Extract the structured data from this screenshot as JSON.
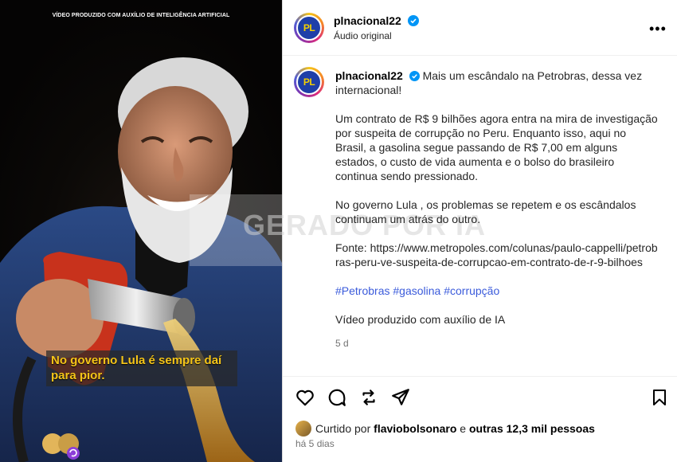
{
  "media": {
    "ai_notice": "VÍDEO PRODUZIDO COM AUXÍLIO DE INTELIGÊNCIA ARTIFICIAL",
    "watermark": "GERADO POR IA",
    "caption": "No governo Lula é sempre daí para pior."
  },
  "header": {
    "avatar_text": "PL",
    "username": "plnacional22",
    "audio": "Áudio original",
    "more_icon": "ellipsis-icon"
  },
  "post": {
    "avatar_text": "PL",
    "username": "plnacional22",
    "intro": "Mais um escândalo na Petrobras, dessa vez internacional!",
    "paragraph1": "Um contrato de R$ 9 bilhões agora entra na mira de investigação por suspeita de corrupção no Peru. Enquanto isso, aqui no Brasil, a gasolina segue passando de R$ 7,00 em alguns estados, o custo de vida aumenta e o bolso do brasileiro continua sendo pressionado.",
    "paragraph2": "No governo Lula , os problemas se repetem e os escândalos continuam um atrás do outro.",
    "source": "Fonte: https://www.metropoles.com/colunas/paulo-cappelli/petrobras-peru-ve-suspeita-de-corrupcao-em-contrato-de-r-9-bilhoes",
    "hashtags": [
      "#Petrobras",
      "#gasolina",
      "#corrupção"
    ],
    "ai_note": "Vídeo produzido com auxílio de IA",
    "time": "5 d"
  },
  "actions": {
    "like_icon": "heart-icon",
    "comment_icon": "comment-icon",
    "share_icon": "repost-icon",
    "send_icon": "send-icon",
    "save_icon": "bookmark-icon"
  },
  "likes": {
    "prefix": "Curtido por",
    "user": "flaviobolsonaro",
    "connector": "e",
    "others": "outras 12,3 mil pessoas"
  },
  "ago": "há 5 dias",
  "colors": {
    "accent_blue": "#3b5bdb",
    "verified_blue": "#0095f6",
    "caption_yellow": "#f5c518"
  }
}
